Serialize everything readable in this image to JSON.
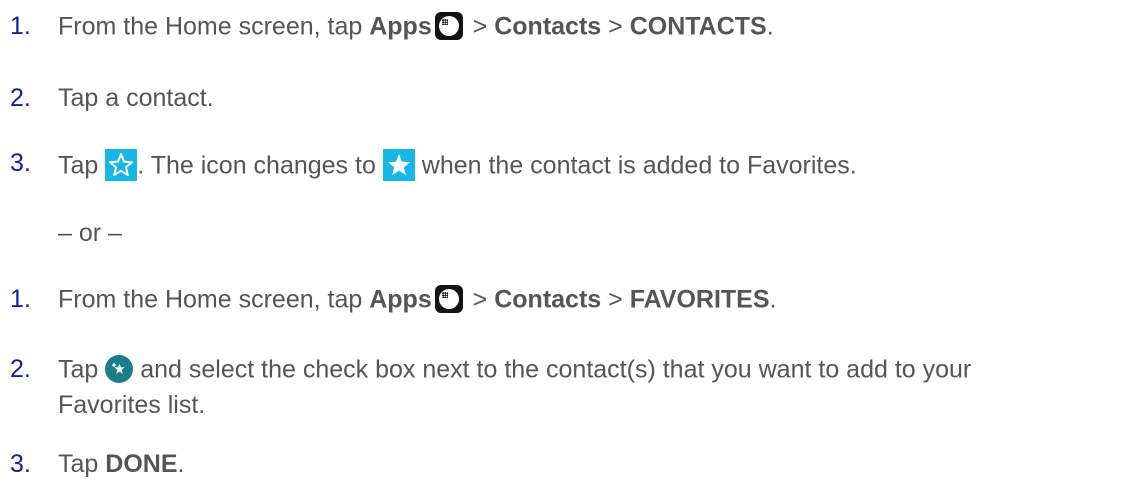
{
  "steps_a": [
    {
      "num": "1.",
      "prefix": "From the Home screen, tap ",
      "apps": "Apps",
      "sep1": " > ",
      "contacts": "Contacts",
      "sep2": " > ",
      "target": "CONTACTS",
      "end": "."
    },
    {
      "num": "2.",
      "text": "Tap a contact."
    },
    {
      "num": "3.",
      "prefix": "Tap ",
      "middle": ". The icon changes to ",
      "suffix": " when the contact is added to Favorites."
    }
  ],
  "or_text": "– or –",
  "steps_b": [
    {
      "num": "1.",
      "prefix": "From the Home screen, tap ",
      "apps": "Apps",
      "sep1": " > ",
      "contacts": "Contacts",
      "sep2": " > ",
      "target": "FAVORITES",
      "end": "."
    },
    {
      "num": "2.",
      "prefix": "Tap ",
      "line1": " and select the check box next to the contact(s) that you want to add to your",
      "line2": "Favorites list."
    },
    {
      "num": "3.",
      "prefix": "Tap ",
      "bold": "DONE",
      "end": "."
    }
  ],
  "icons": {
    "apps": "apps-grid-icon",
    "star_outline": "star-outline-icon",
    "star_filled": "star-filled-icon",
    "add_favorite": "add-favorite-icon"
  },
  "colors": {
    "number": "#1a1a9a",
    "text": "#555555",
    "star_bg": "#17b6e6",
    "fab": "#1b7c8c"
  }
}
